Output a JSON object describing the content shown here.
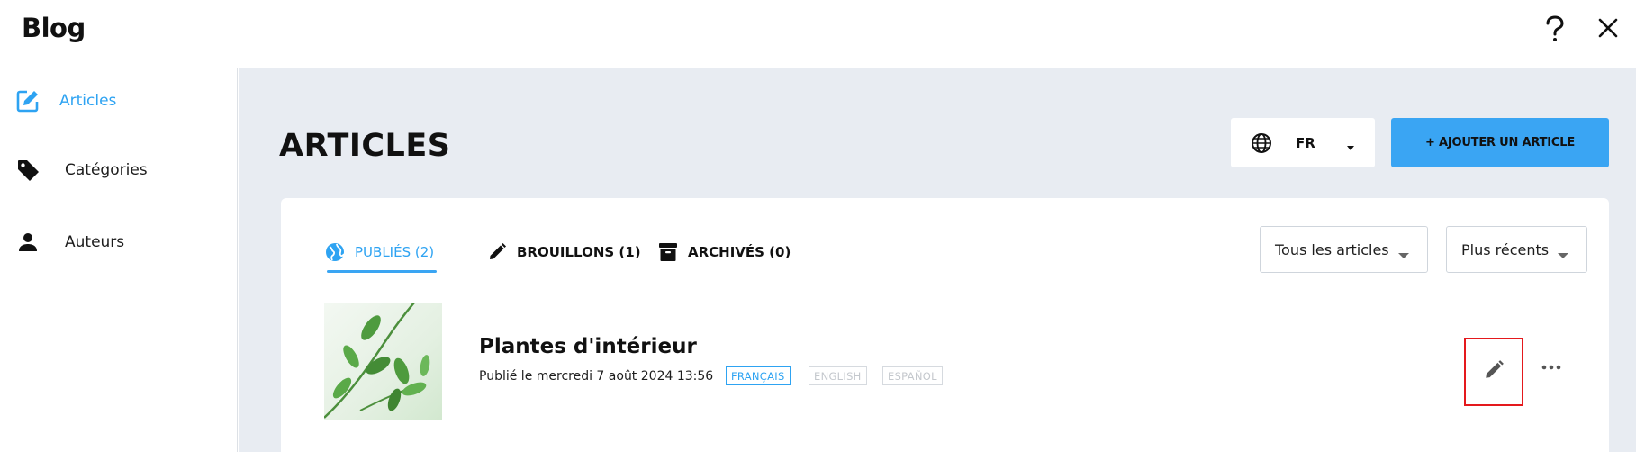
{
  "app": {
    "title": "Blog"
  },
  "header": {
    "help_icon": "question-mark-icon",
    "close_icon": "close-icon"
  },
  "sidebar": {
    "items": [
      {
        "label": "Articles",
        "icon": "edit-square-icon",
        "active": true
      },
      {
        "label": "Catégories",
        "icon": "tag-icon",
        "active": false
      },
      {
        "label": "Auteurs",
        "icon": "person-icon",
        "active": false
      }
    ]
  },
  "main": {
    "title": "ARTICLES",
    "language": {
      "code": "FR",
      "icon": "globe-icon"
    },
    "add_button": "+ AJOUTER UN ARTICLE",
    "tabs": [
      {
        "label": "PUBLIÉS (2)",
        "icon": "globe-icon",
        "active": true
      },
      {
        "label": "BROUILLONS (1)",
        "icon": "pencil-icon",
        "active": false
      },
      {
        "label": "ARCHIVÉS (0)",
        "icon": "archive-box-icon",
        "active": false
      }
    ],
    "filters": {
      "type": "Tous les articles",
      "sort": "Plus récents"
    },
    "articles": [
      {
        "title": "Plantes d'intérieur",
        "date": "Publié le mercredi 7 août 2024 13:56",
        "languages": [
          {
            "label": "FRANÇAIS",
            "active": true
          },
          {
            "label": "ENGLISH",
            "active": false
          },
          {
            "label": "ESPAÑOL",
            "active": false
          }
        ]
      }
    ]
  },
  "colors": {
    "accent": "#3aa5f3",
    "accent_text": "#2ea3f2",
    "main_bg": "#e8ecf2",
    "highlight": "#e4191d"
  }
}
